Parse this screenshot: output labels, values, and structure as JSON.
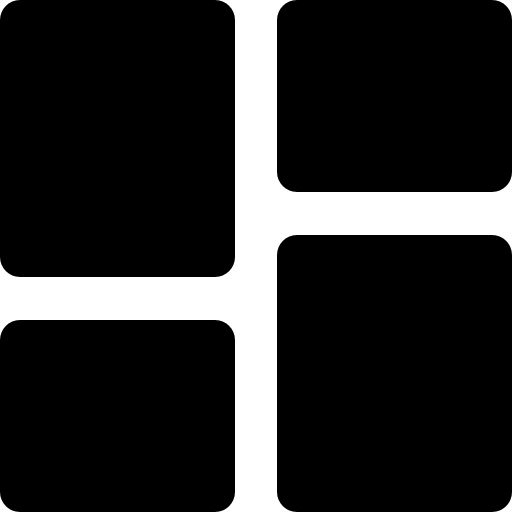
{
  "icon": {
    "name": "dashboard-layout-icon",
    "fill_color": "#000000",
    "background_color": "#ffffff"
  }
}
